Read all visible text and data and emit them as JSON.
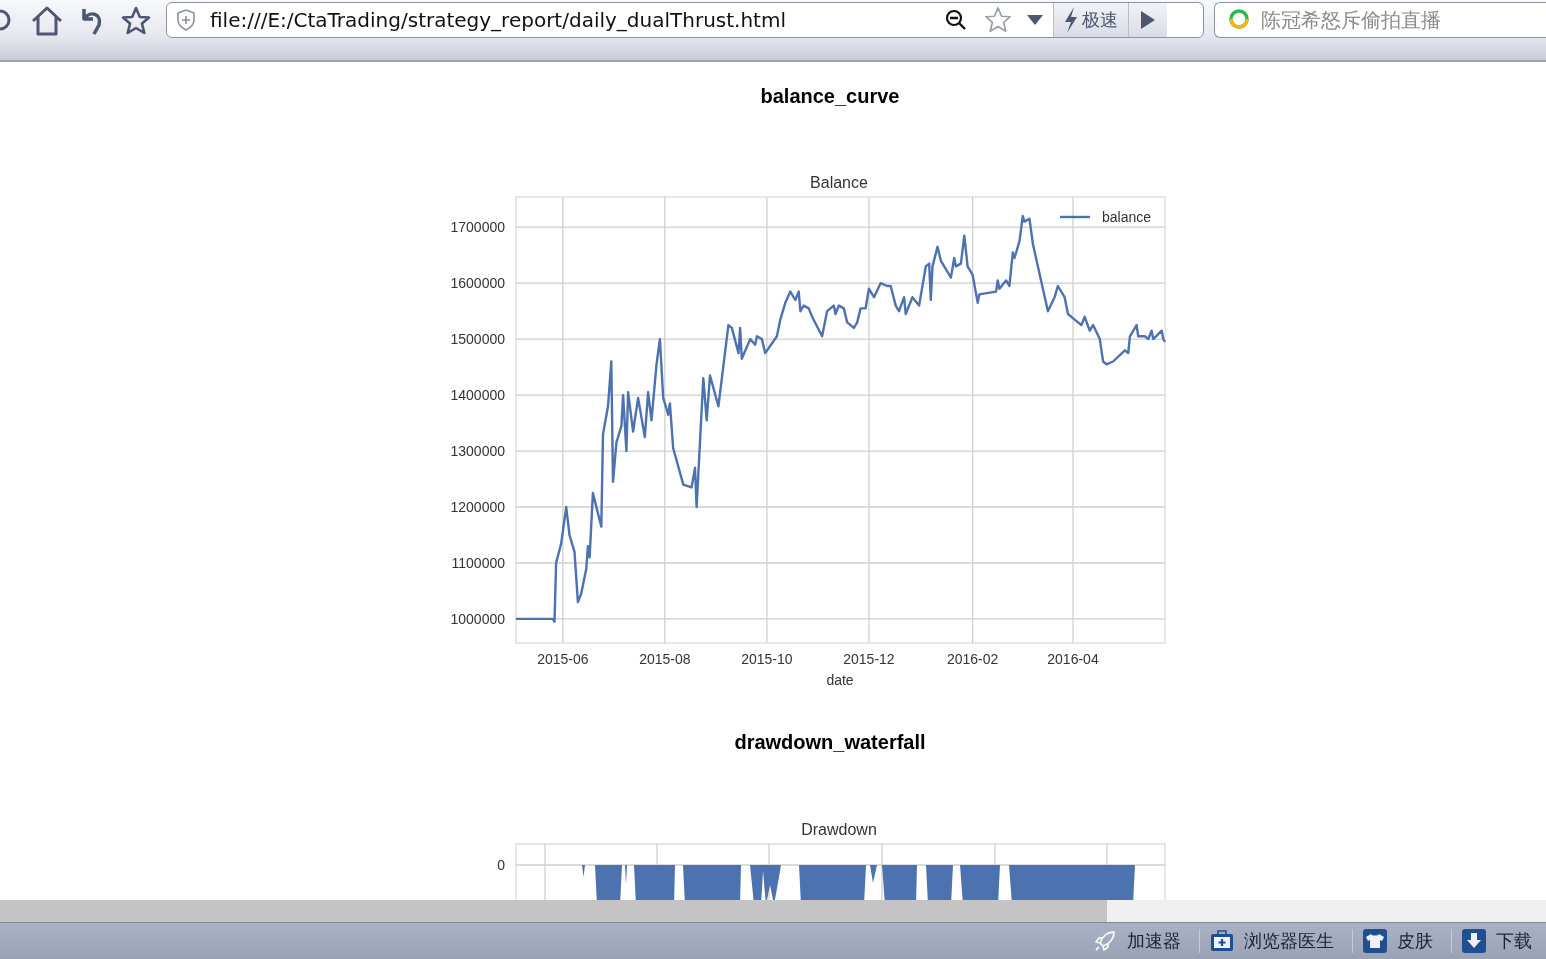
{
  "toolbar": {
    "address": "file:///E:/CtaTrading/strategy_report/daily_dualThrust.html",
    "speed_mode": "极速",
    "search": {
      "placeholder": "陈冠希怒斥偷拍直播"
    }
  },
  "sections": [
    {
      "kind": "line_chart",
      "heading": "balance_curve",
      "chart_data": {
        "type": "line",
        "title": "Balance",
        "xlabel": "date",
        "x": [
          "2015-05-04",
          "2015-05-26",
          "2015-05-27",
          "2015-05-28",
          "2015-05-31",
          "2015-06-03",
          "2015-06-05",
          "2015-06-08",
          "2015-06-10",
          "2015-06-12",
          "2015-06-15",
          "2015-06-16",
          "2015-06-17",
          "2015-06-19",
          "2015-06-24",
          "2015-06-25",
          "2015-06-28",
          "2015-06-30",
          "2015-07-01",
          "2015-07-03",
          "2015-07-06",
          "2015-07-07",
          "2015-07-09",
          "2015-07-10",
          "2015-07-13",
          "2015-07-16",
          "2015-07-20",
          "2015-07-22",
          "2015-07-24",
          "2015-07-27",
          "2015-07-29",
          "2015-07-31",
          "2015-08-03",
          "2015-08-04",
          "2015-08-06",
          "2015-08-12",
          "2015-08-17",
          "2015-08-19",
          "2015-08-20",
          "2015-08-24",
          "2015-08-26",
          "2015-08-28",
          "2015-09-02",
          "2015-09-08",
          "2015-09-10",
          "2015-09-14",
          "2015-09-15",
          "2015-09-16",
          "2015-09-21",
          "2015-09-24",
          "2015-09-25",
          "2015-09-28",
          "2015-09-30",
          "2015-10-07",
          "2015-10-09",
          "2015-10-12",
          "2015-10-15",
          "2015-10-18",
          "2015-10-20",
          "2015-10-21",
          "2015-10-23",
          "2015-10-26",
          "2015-10-28",
          "2015-11-03",
          "2015-11-06",
          "2015-11-10",
          "2015-11-11",
          "2015-11-13",
          "2015-11-16",
          "2015-11-18",
          "2015-11-22",
          "2015-11-24",
          "2015-11-26",
          "2015-11-29",
          "2015-12-01",
          "2015-12-04",
          "2015-12-08",
          "2015-12-12",
          "2015-12-14",
          "2015-12-17",
          "2015-12-19",
          "2015-12-22",
          "2015-12-23",
          "2015-12-27",
          "2015-12-31",
          "2016-01-04",
          "2016-01-06",
          "2016-01-07",
          "2016-01-08",
          "2016-01-11",
          "2016-01-13",
          "2016-01-16",
          "2016-01-19",
          "2016-01-21",
          "2016-01-22",
          "2016-01-25",
          "2016-01-27",
          "2016-01-29",
          "2016-02-01",
          "2016-02-04",
          "2016-02-05",
          "2016-02-15",
          "2016-02-16",
          "2016-02-17",
          "2016-02-21",
          "2016-02-23",
          "2016-02-25",
          "2016-02-26",
          "2016-02-29",
          "2016-03-02",
          "2016-03-03",
          "2016-03-06",
          "2016-03-08",
          "2016-03-11",
          "2016-03-14",
          "2016-03-17",
          "2016-03-21",
          "2016-03-23",
          "2016-03-27",
          "2016-03-29",
          "2016-04-02",
          "2016-04-06",
          "2016-04-08",
          "2016-04-11",
          "2016-04-13",
          "2016-04-17",
          "2016-04-19",
          "2016-04-21",
          "2016-04-25",
          "2016-05-02",
          "2016-05-04",
          "2016-05-05",
          "2016-05-09",
          "2016-05-10",
          "2016-05-14",
          "2016-05-16",
          "2016-05-18",
          "2016-05-19",
          "2016-05-24",
          "2016-05-25",
          "2016-05-26"
        ],
        "series": [
          {
            "name": "balance",
            "color": "#4c72b0",
            "values": [
              1000000,
              1000000,
              995000,
              1100000,
              1135000,
              1200000,
              1150000,
              1120000,
              1030000,
              1045000,
              1090000,
              1130000,
              1110000,
              1225000,
              1165000,
              1330000,
              1380000,
              1460000,
              1245000,
              1315000,
              1345000,
              1400000,
              1300000,
              1405000,
              1335000,
              1395000,
              1325000,
              1405000,
              1355000,
              1455000,
              1500000,
              1395000,
              1365000,
              1385000,
              1305000,
              1240000,
              1235000,
              1270000,
              1200000,
              1430000,
              1355000,
              1435000,
              1380000,
              1525000,
              1520000,
              1475000,
              1520000,
              1465000,
              1500000,
              1490000,
              1505000,
              1500000,
              1475000,
              1505000,
              1535000,
              1565000,
              1585000,
              1570000,
              1585000,
              1550000,
              1560000,
              1555000,
              1540000,
              1505000,
              1550000,
              1560000,
              1545000,
              1560000,
              1555000,
              1530000,
              1520000,
              1530000,
              1555000,
              1555000,
              1590000,
              1575000,
              1600000,
              1595000,
              1595000,
              1560000,
              1550000,
              1575000,
              1545000,
              1575000,
              1560000,
              1630000,
              1635000,
              1570000,
              1630000,
              1665000,
              1640000,
              1625000,
              1610000,
              1645000,
              1630000,
              1635000,
              1685000,
              1630000,
              1615000,
              1565000,
              1580000,
              1585000,
              1605000,
              1590000,
              1605000,
              1595000,
              1655000,
              1645000,
              1675000,
              1720000,
              1710000,
              1715000,
              1670000,
              1630000,
              1590000,
              1550000,
              1575000,
              1595000,
              1575000,
              1545000,
              1535000,
              1525000,
              1540000,
              1515000,
              1525000,
              1500000,
              1460000,
              1455000,
              1460000,
              1480000,
              1475000,
              1505000,
              1525000,
              1505000,
              1505000,
              1500000,
              1515000,
              1500000,
              1515000,
              1500000,
              1495000
            ]
          }
        ],
        "xlim": [
          "2015-05-04",
          "2016-05-26"
        ],
        "ylim": [
          957000,
          1754000
        ],
        "xticks": [
          {
            "value": "2015-06-01",
            "label": "2015-06"
          },
          {
            "value": "2015-08-01",
            "label": "2015-08"
          },
          {
            "value": "2015-10-01",
            "label": "2015-10"
          },
          {
            "value": "2015-12-01",
            "label": "2015-12"
          },
          {
            "value": "2016-02-01",
            "label": "2016-02"
          },
          {
            "value": "2016-04-01",
            "label": "2016-04"
          }
        ],
        "yticks": [
          1000000,
          1100000,
          1200000,
          1300000,
          1400000,
          1500000,
          1600000,
          1700000
        ],
        "grid": true
      }
    },
    {
      "kind": "drawdown_picture",
      "heading": "drawdown_waterfall",
      "chart": {
        "title": "Drawdown",
        "ytick_label": "0"
      }
    }
  ],
  "status_bar": {
    "items": [
      {
        "label": "加速器"
      },
      {
        "label": "浏览器医生"
      },
      {
        "label": "皮肤"
      },
      {
        "label": "下载"
      }
    ]
  }
}
